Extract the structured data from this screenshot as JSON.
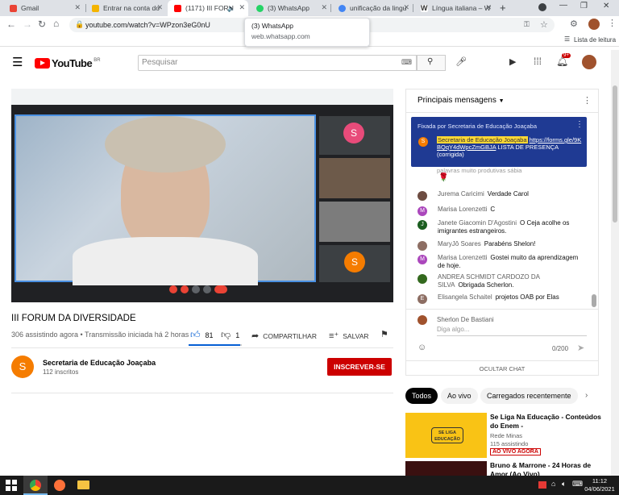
{
  "tabs": [
    {
      "title": "Gmail",
      "color": "#ea4335"
    },
    {
      "title": "Entrar na conta do",
      "color": "#f4b400"
    },
    {
      "title": "(1171) III FORU",
      "color": "#ff0000"
    },
    {
      "title": "(3) WhatsApp",
      "color": "#25d366"
    },
    {
      "title": "unificação da lingu",
      "color": "#4285f4"
    },
    {
      "title": "Língua italiana – W",
      "color": "#555555"
    }
  ],
  "address": "youtube.com/watch?v=WPzon3eG0nU",
  "bookmarks_label": "Lista de leitura",
  "tooltip": {
    "title": "(3) WhatsApp",
    "url": "web.whatsapp.com"
  },
  "yt": {
    "logo": "YouTube",
    "country": "BR",
    "search_placeholder": "Pesquisar",
    "notif": "9+"
  },
  "video": {
    "title": "III FORUM DA DIVERSIDADE",
    "meta": "306 assistindo agora • Transmissão iniciada há 2 horas",
    "likes": "81",
    "dislikes": "1",
    "share": "COMPARTILHAR",
    "save": "SALVAR",
    "p1": "S",
    "p2": "S"
  },
  "channel": {
    "name": "Secretaria de Educação Joaçaba",
    "subs": "112 inscritos",
    "avatar": "S",
    "subscribe": "INSCREVER-SE"
  },
  "chat": {
    "header": "Principais mensagens",
    "pinned_label": "Fixada por Secretaria de Educação Joaçaba",
    "pinned_author": "Secretaria de Educação Joaçaba",
    "pinned_link": "https://forms.gle/9KBQqY4dWpcZmGBJA",
    "pinned_text": "LISTA DE PRESENÇA (corrigida)",
    "partial": "palavras muito produtivas sábia",
    "messages": [
      {
        "author": "Jurema Caricimi",
        "text": "Verdade Carol",
        "color": "#6d4c41",
        "init": ""
      },
      {
        "author": "Marisa Lorenzetti",
        "text": "C",
        "color": "#ab47bc",
        "init": "M"
      },
      {
        "author": "Janete Giacomin D'Agostini",
        "text": "O Ceja acolhe os imigrantes estrangeiros.",
        "color": "#1b5e20",
        "init": "J"
      },
      {
        "author": "MaryJô Soares",
        "text": "Parabéns Shelon!",
        "color": "#8d6e63",
        "init": ""
      },
      {
        "author": "Marisa Lorenzetti",
        "text": "Gostei muito da aprendizagem de hoje.",
        "color": "#ab47bc",
        "init": "M"
      },
      {
        "author": "ANDREA SCHMIDT CARDOZO DA SILVA",
        "text": "Obrigada Scherlon.",
        "color": "#33691e",
        "init": ""
      },
      {
        "author": "Elisangela Schaitel",
        "text": "projetos OAB por Elas",
        "color": "#8d6e63",
        "init": "E"
      }
    ],
    "user": "Sherlon De Bastiani",
    "input_placeholder": "Diga algo...",
    "counter": "0/200",
    "hide": "OCULTAR CHAT"
  },
  "chips": [
    "Todos",
    "Ao vivo",
    "Carregados recentemente"
  ],
  "recs": [
    {
      "title": "Se Liga Na Educação - Conteúdos do Enem -",
      "channel": "Rede Minas",
      "stat": "115 assistindo",
      "badge": "AO VIVO AGORA",
      "thumb": "SE LIGA EDUCAÇÃO"
    },
    {
      "title": "Bruno & Marrone - 24 Horas de Amor (Ao Vivo)",
      "channel": "",
      "stat": "",
      "badge": "",
      "thumb": ""
    }
  ],
  "clock": {
    "time": "11:12",
    "date": "04/06/2021"
  }
}
